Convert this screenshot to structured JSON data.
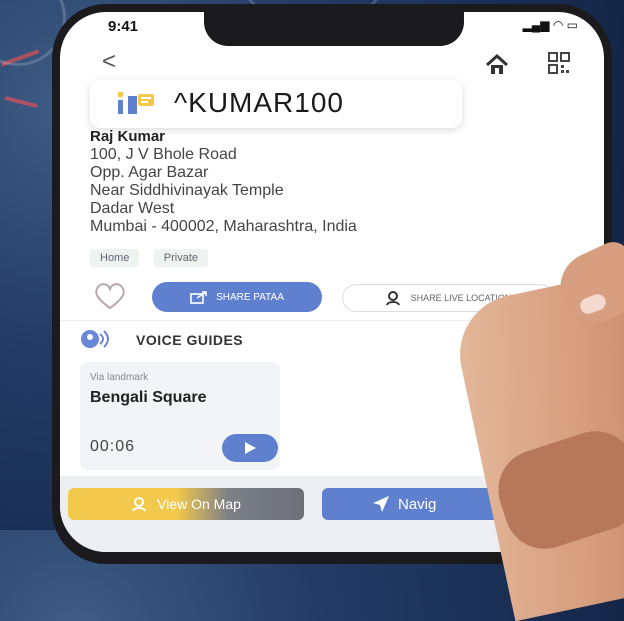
{
  "status_bar": {
    "time": "9:41",
    "icons": "▂▄▆ ◠ ▭"
  },
  "header": {
    "back_glyph": "<",
    "home_icon": "home-icon",
    "qr_icon": "qr-code-icon"
  },
  "address_code": {
    "logo_icon": "pataa-logo-icon",
    "code": "^KUMAR100"
  },
  "address": {
    "name": "Raj Kumar",
    "lines": [
      "100, J V Bhole Road",
      "Opp. Agar Bazar",
      "Near Siddhivinayak Temple",
      "Dadar West",
      "Mumbai - 400002, Maharashtra, India"
    ]
  },
  "tags": [
    "Home",
    "Private"
  ],
  "actions": {
    "favorite_icon": "heart-icon",
    "share_label": "SHARE PATAA",
    "share_icon": "share-icon",
    "live_location_label": "SHARE LIVE LOCATION",
    "live_location_icon": "location-person-icon"
  },
  "voice_guides": {
    "section_icon": "voice-guide-icon",
    "title": "VOICE GUIDES",
    "card": {
      "caption": "Via landmark",
      "place": "Bengali Square",
      "duration": "00:06",
      "play_icon": "play-icon"
    }
  },
  "bottom_bar": {
    "view_map_label": "View On Map",
    "view_map_icon": "map-pin-icon",
    "navigate_label": "Navig",
    "navigate_icon": "navigation-arrow-icon"
  },
  "colors": {
    "accent_blue": "#5f7fcf",
    "accent_yellow": "#f2c94c",
    "background_navy": "#1a2d52"
  }
}
